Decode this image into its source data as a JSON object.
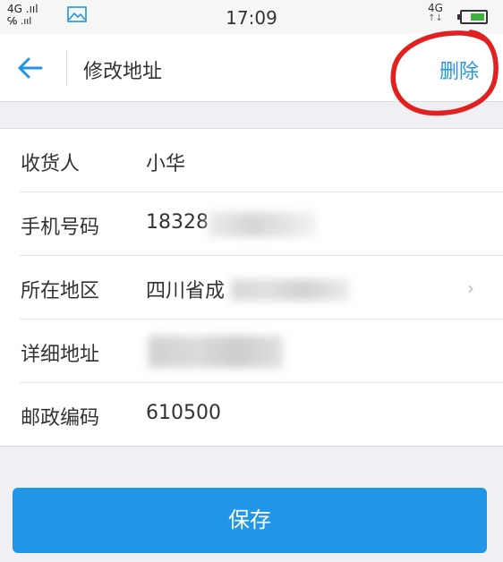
{
  "status_bar": {
    "signal_line1": "4G .ııl",
    "signal_line2": "℅ .ııl",
    "time": "17:09",
    "network": "4G",
    "network_arrows": "↑↓"
  },
  "header": {
    "title": "修改地址",
    "delete_label": "删除"
  },
  "form": {
    "rows": [
      {
        "label": "收货人",
        "value": "小华"
      },
      {
        "label": "手机号码",
        "value": "18328"
      },
      {
        "label": "所在地区",
        "value": "四川省成"
      },
      {
        "label": "详细地址",
        "value": ""
      },
      {
        "label": "邮政编码",
        "value": "610500"
      }
    ],
    "chevron": "›"
  },
  "actions": {
    "save_label": "保存"
  },
  "colors": {
    "accent": "#2196e6",
    "annotation_circle": "#e32020",
    "background": "#efeff4"
  }
}
